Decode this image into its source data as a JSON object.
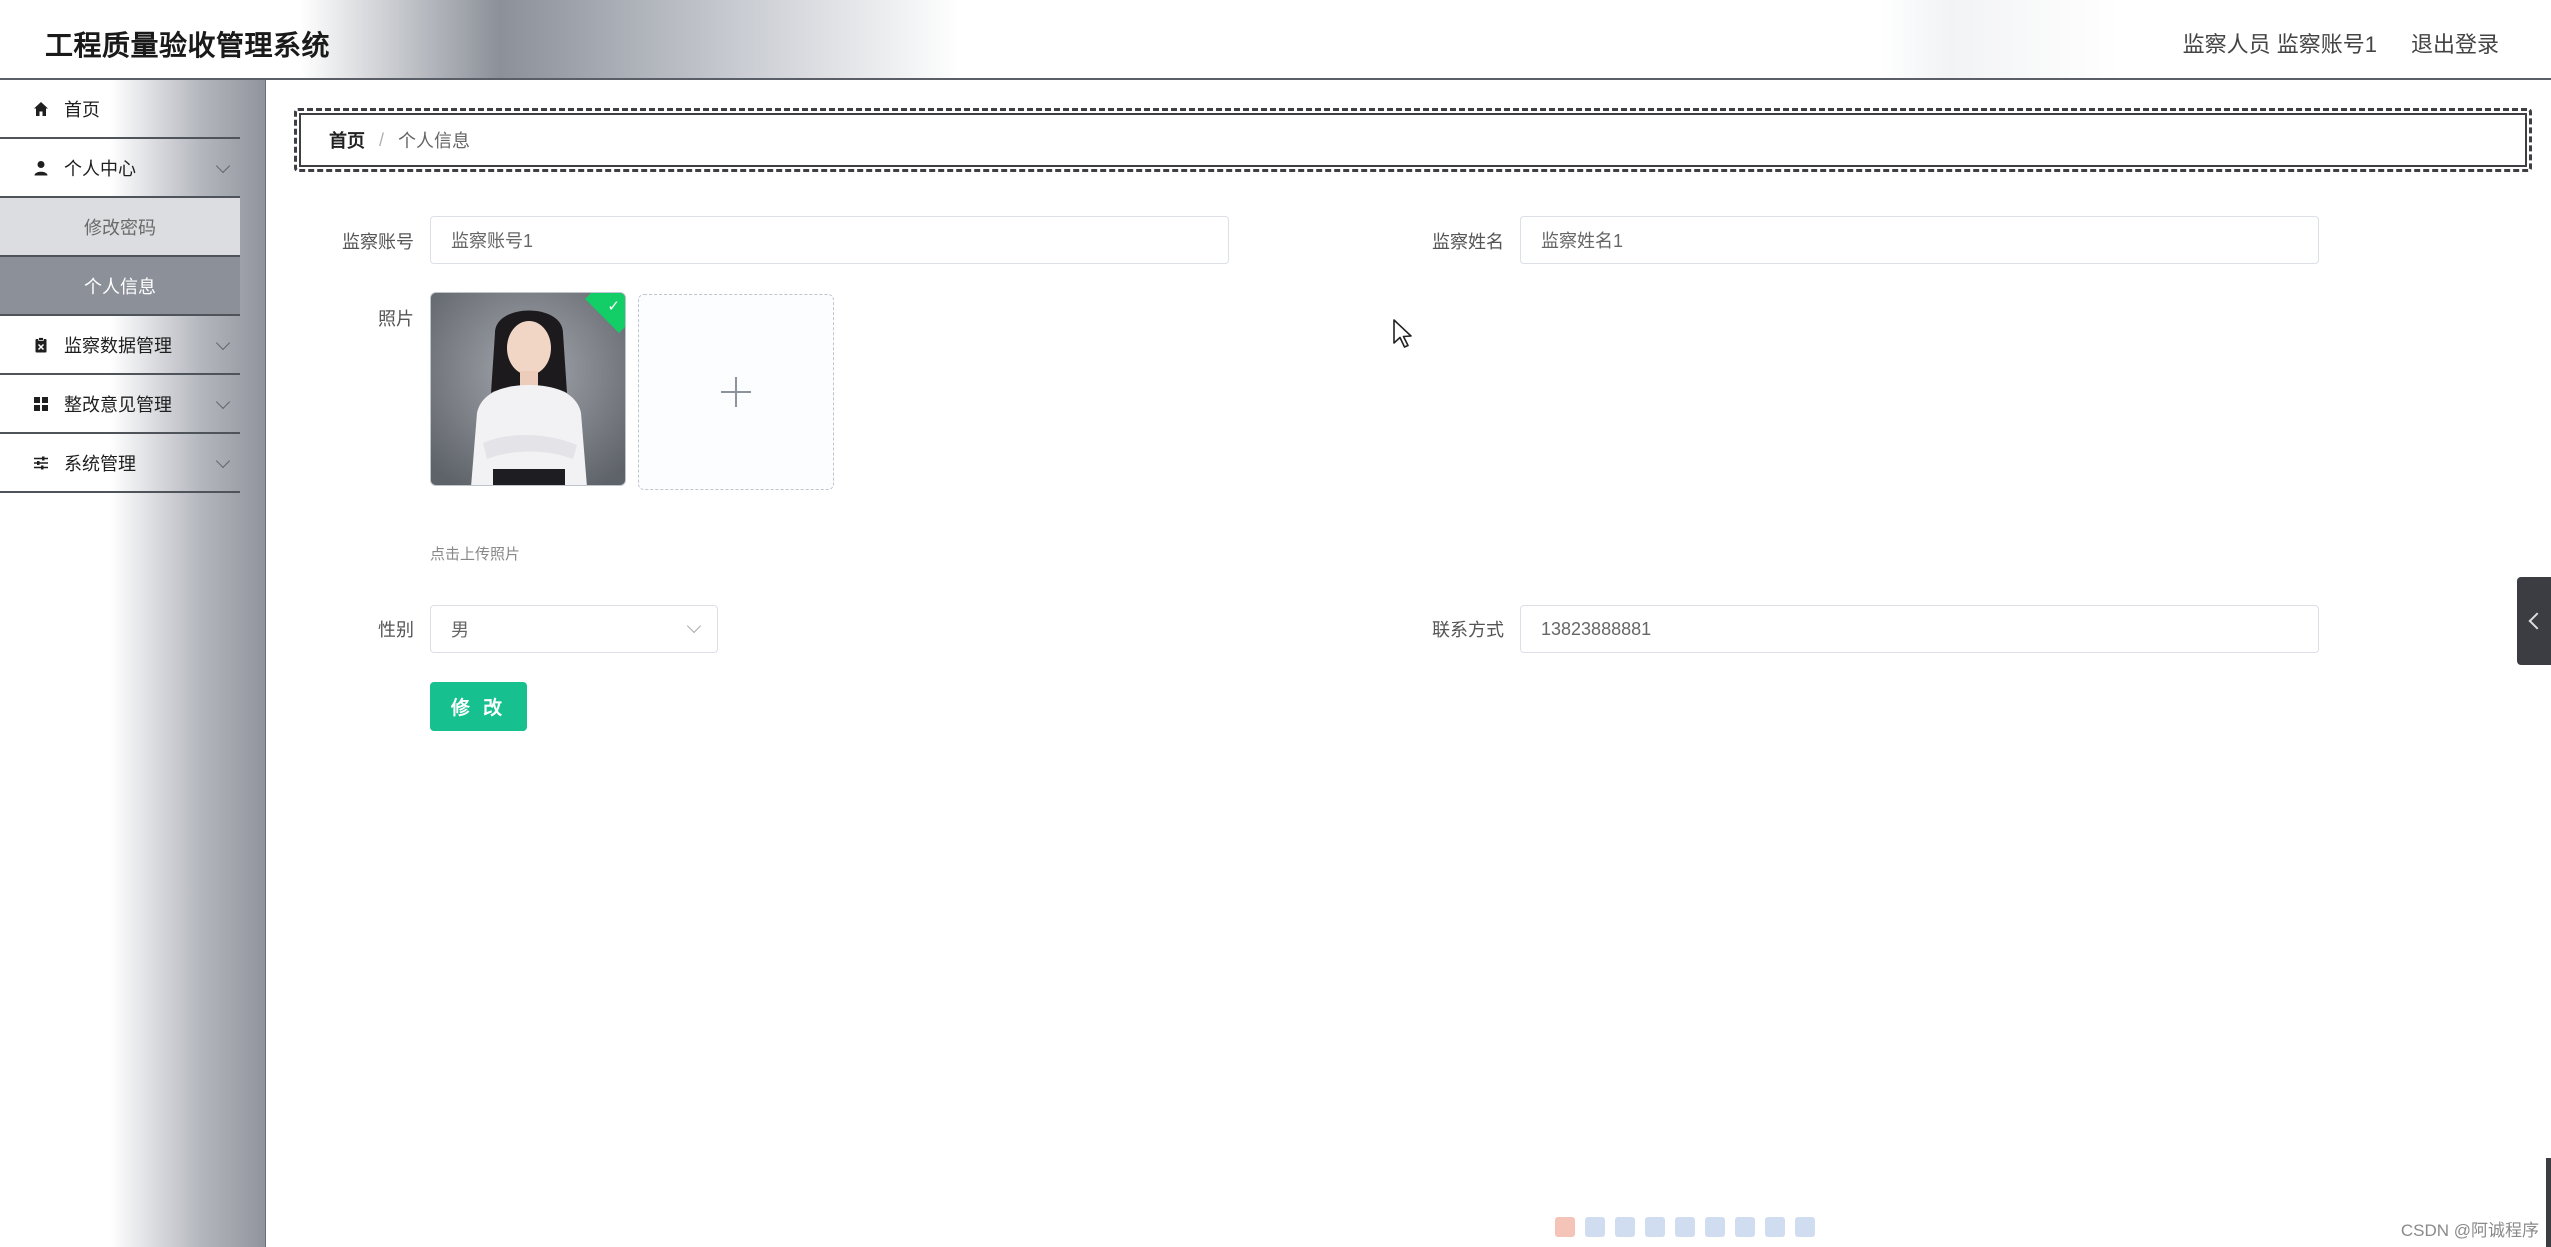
{
  "header": {
    "title": "工程质量验收管理系统",
    "user_info": "监察人员 监察账号1",
    "logout_label": "退出登录"
  },
  "sidebar": {
    "items": [
      {
        "label": "首页",
        "icon": "home-icon"
      },
      {
        "label": "个人中心",
        "icon": "user-icon",
        "expanded": true,
        "children": [
          {
            "label": "修改密码"
          },
          {
            "label": "个人信息",
            "active": true
          }
        ]
      },
      {
        "label": "监察数据管理",
        "icon": "clipboard-icon"
      },
      {
        "label": "整改意见管理",
        "icon": "grid-icon"
      },
      {
        "label": "系统管理",
        "icon": "sliders-icon"
      }
    ]
  },
  "breadcrumb": {
    "home": "首页",
    "separator": "/",
    "current": "个人信息"
  },
  "form": {
    "account": {
      "label": "监察账号",
      "value": "监察账号1"
    },
    "name": {
      "label": "监察姓名",
      "value": "监察姓名1"
    },
    "photo": {
      "label": "照片",
      "hint": "点击上传照片"
    },
    "gender": {
      "label": "性别",
      "value": "男"
    },
    "contact": {
      "label": "联系方式",
      "value": "13823888881"
    },
    "submit_label": "修 改"
  },
  "colors": {
    "accent": "#17c08f",
    "success": "#13ce66",
    "sidebar_active": "#8c9099"
  },
  "watermark": "CSDN @阿诚程序"
}
